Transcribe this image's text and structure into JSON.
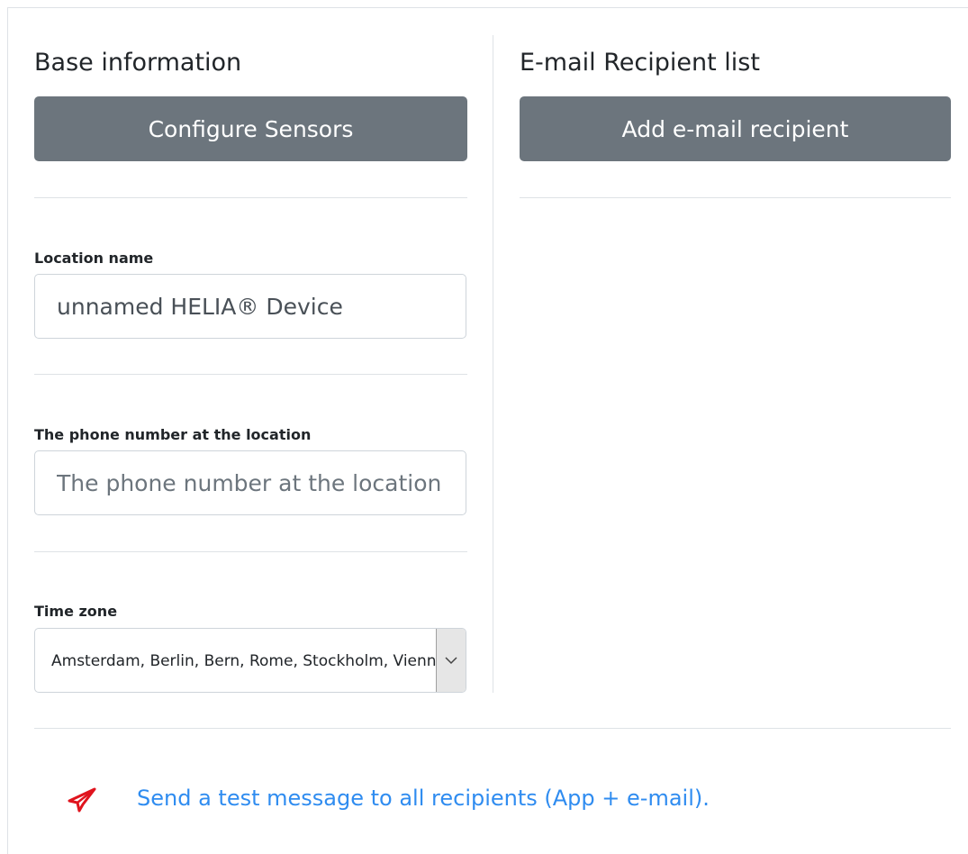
{
  "base_info": {
    "title": "Base information",
    "configure_button": "Configure Sensors",
    "location_name": {
      "label": "Location name",
      "value": "unnamed HELIA® Device"
    },
    "phone": {
      "label": "The phone number at the location",
      "placeholder": "The phone number at the location"
    },
    "time_zone": {
      "label": "Time zone",
      "selected": "Amsterdam, Berlin, Bern, Rome, Stockholm, Vienna"
    }
  },
  "recipients": {
    "title": "E-mail Recipient list",
    "add_button": "Add e-mail recipient"
  },
  "footer": {
    "send_test_link": "Send a test message to all recipients (App + e-mail).",
    "icon": "paper-plane-icon",
    "icon_color": "#e0141e",
    "link_color": "#2f8cf0"
  },
  "colors": {
    "button_bg": "#6c757d",
    "divider": "#dee2e6"
  }
}
